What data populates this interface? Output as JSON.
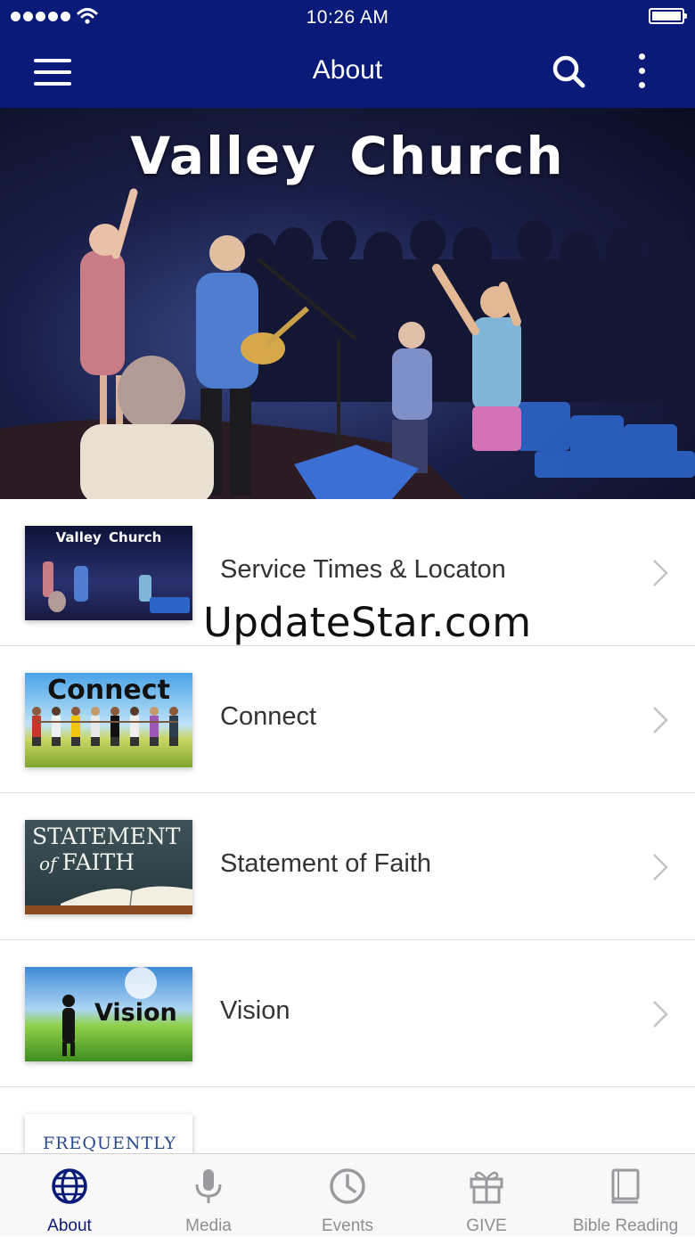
{
  "status_bar": {
    "time": "10:26 AM",
    "signal_icon": "signal-dots-icon",
    "wifi_icon": "wifi-icon",
    "battery_icon": "battery-icon"
  },
  "nav_bar": {
    "title": "About",
    "menu_icon": "hamburger-menu-icon",
    "search_icon": "search-icon",
    "more_icon": "more-vertical-icon"
  },
  "hero": {
    "title": "Valley Church"
  },
  "list": {
    "items": [
      {
        "label": "Service Times & Locaton",
        "thumb_text": "Valley Church"
      },
      {
        "label": "Connect",
        "thumb_text": "Connect"
      },
      {
        "label": "Statement of Faith",
        "thumb_text_line1": "STATEMENT",
        "thumb_text_of": "of",
        "thumb_text_line2": "FAITH"
      },
      {
        "label": "Vision",
        "thumb_text": "Vision"
      },
      {
        "label": "",
        "thumb_text": "FREQUENTLY ASKED"
      }
    ]
  },
  "watermark": "UpdateStar.com",
  "tab_bar": {
    "active": "About",
    "tabs": [
      {
        "label": "About",
        "icon": "globe-icon"
      },
      {
        "label": "Media",
        "icon": "microphone-icon"
      },
      {
        "label": "Events",
        "icon": "clock-icon"
      },
      {
        "label": "GIVE",
        "icon": "gift-icon"
      },
      {
        "label": "Bible Reading",
        "icon": "book-icon"
      }
    ]
  },
  "colors": {
    "nav_background": "#0a1a78",
    "active_tab": "#0a1a78",
    "inactive_tab": "#8e8e93",
    "row_text": "#333333"
  }
}
